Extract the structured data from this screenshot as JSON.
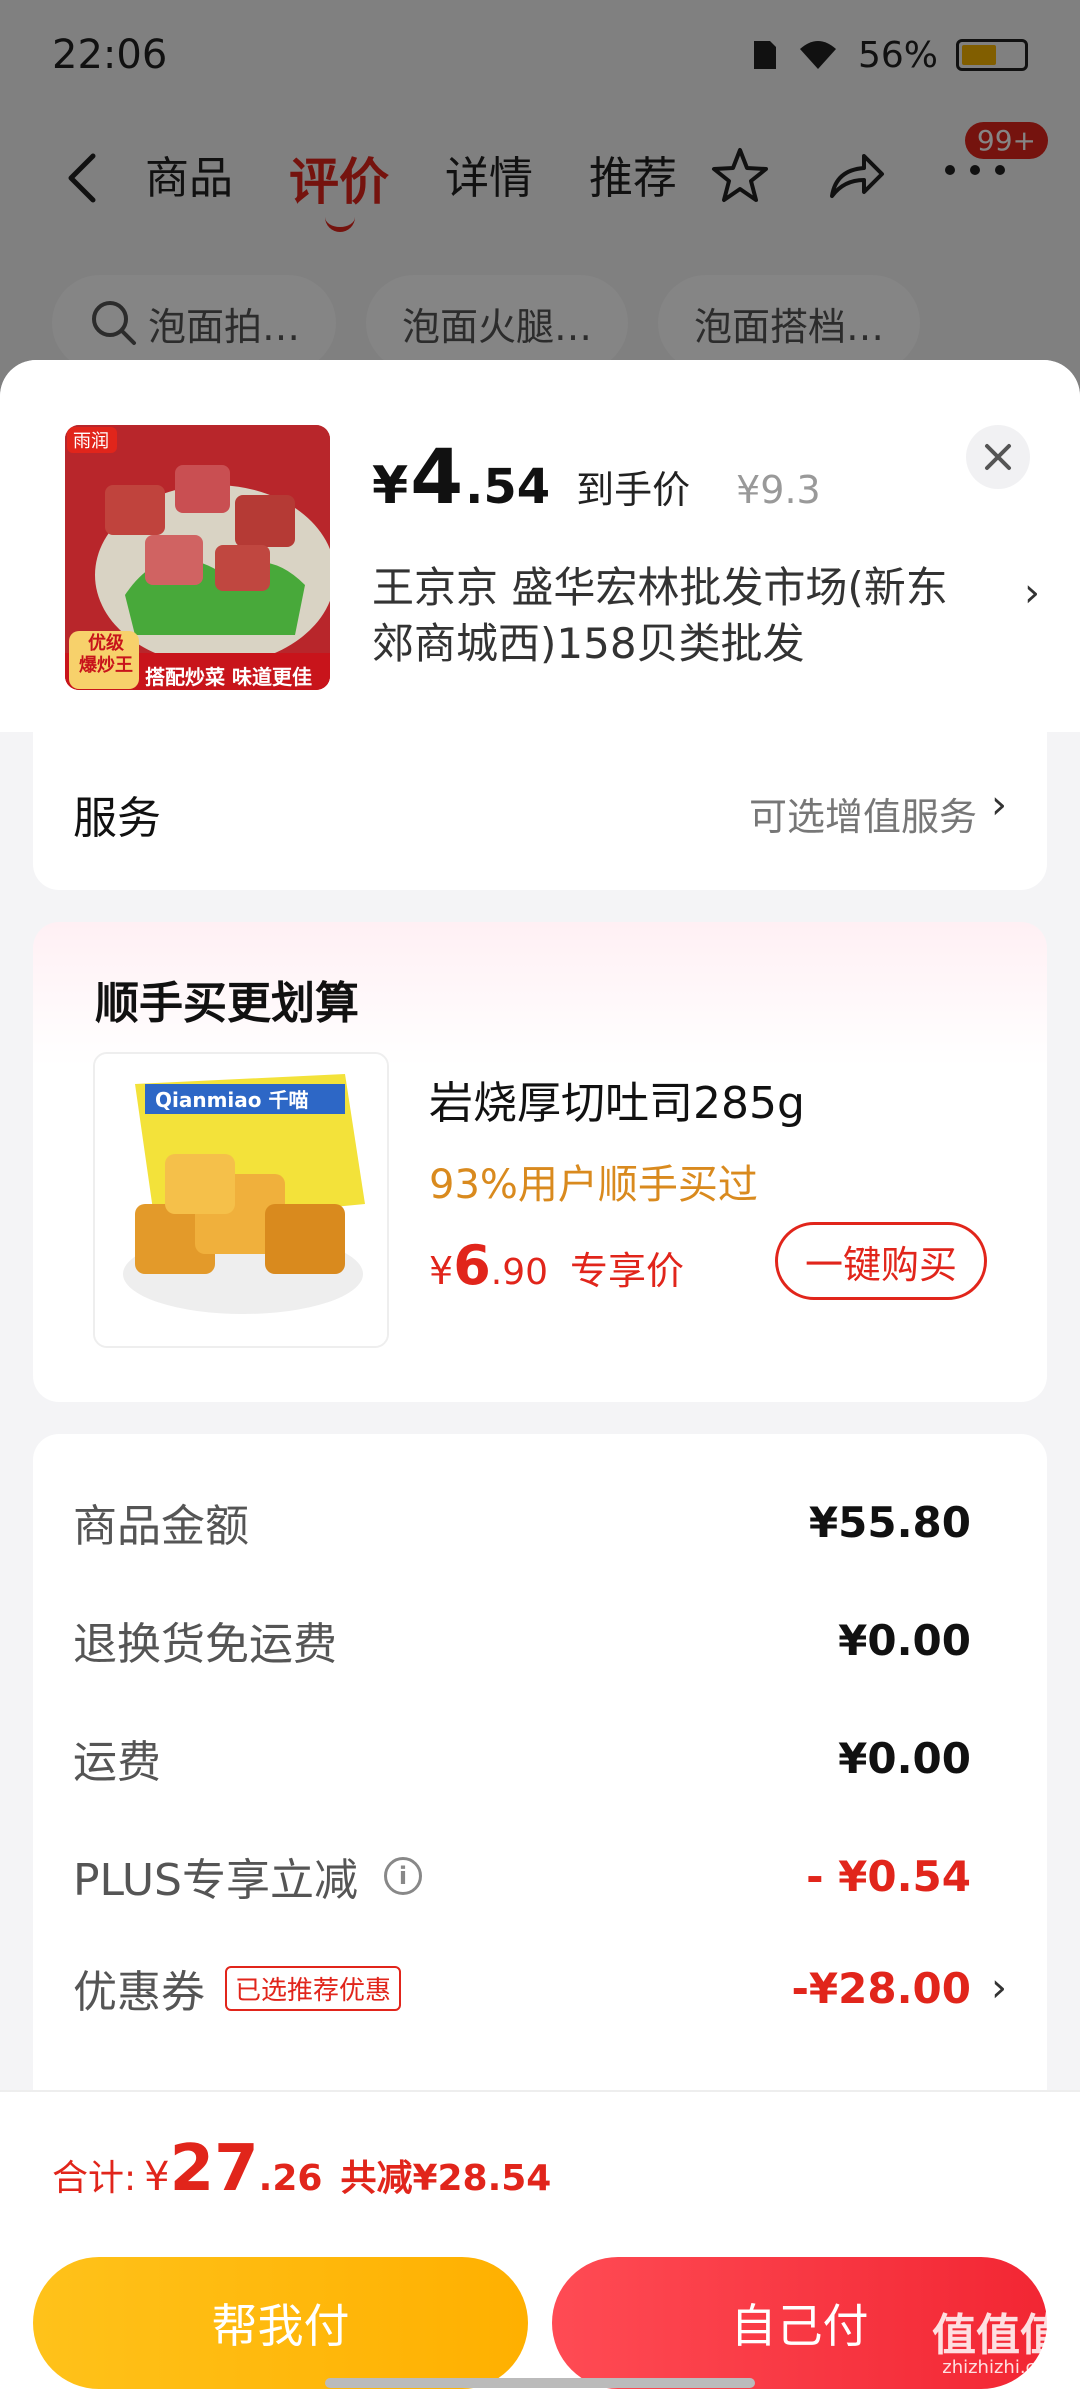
{
  "status_bar": {
    "time": "22:06",
    "battery": "56%",
    "battery_level": 0.56
  },
  "nav": {
    "tabs": [
      {
        "label": "商品"
      },
      {
        "label": "评价"
      },
      {
        "label": "详情"
      },
      {
        "label": "推荐"
      }
    ],
    "active_tab": "评价",
    "more_badge": "99+"
  },
  "chips": [
    {
      "label": "泡面拍…"
    },
    {
      "label": "泡面火腿…"
    },
    {
      "label": "泡面搭档…"
    }
  ],
  "product": {
    "thumb_badge": "优级\n爆炒王",
    "thumb_caption": "搭配炒菜 味道更佳",
    "thumb_brand": "雨润",
    "price_yen": "¥",
    "price_int": "4",
    "price_dec": ".54",
    "price_tag": "到手价",
    "price_old": "¥9.3",
    "address": "王京京  盛华宏林批发市场(新东郊商城西)158贝类批发"
  },
  "service": {
    "title": "服务",
    "value": "可选增值服务"
  },
  "bundle": {
    "title": "顺手买更划算",
    "name": "岩烧厚切吐司285g",
    "rate": "93%用户顺手买过",
    "price_yen": "¥",
    "price_int": "6",
    "price_dec": ".90",
    "price_tag": "专享价",
    "buy_label": "一键购买",
    "img_brand": "Qianmiao 千喵"
  },
  "summary": {
    "rows": [
      {
        "label": "商品金额",
        "value": "¥55.80"
      },
      {
        "label": "退换货免运费",
        "value": "¥0.00"
      },
      {
        "label": "运费",
        "value": "¥0.00"
      },
      {
        "label": "PLUS专享立减",
        "value": "- ¥0.54"
      },
      {
        "label": "优惠券",
        "tag": "已选推荐优惠",
        "value": "-¥28.00"
      }
    ]
  },
  "footer": {
    "total_label": "合计:",
    "total_yen": "¥",
    "total_int": "27",
    "total_dec": ".26",
    "total_save": "共减¥28.54",
    "help_pay": "帮我付",
    "self_pay": "自己付"
  },
  "watermark": {
    "text": "值值值",
    "sub": "zhizhizhi.com"
  },
  "colors": {
    "accent": "#e1251b",
    "help_pay": "#ffb000",
    "self_pay": "#f22633",
    "rate": "#d98a1e"
  },
  "icons": [
    "back-icon",
    "star-icon",
    "share-icon",
    "more-icon",
    "search-icon",
    "close-icon",
    "info-icon",
    "chevron-right-icon"
  ]
}
